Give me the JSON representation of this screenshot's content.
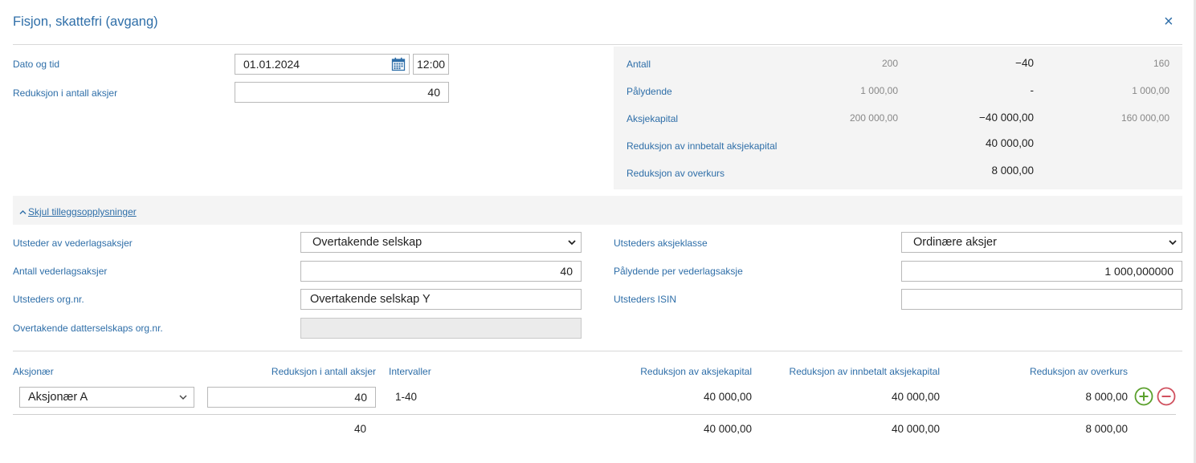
{
  "dialog": {
    "title": "Fisjon, skattefri (avgang)",
    "close_glyph": "×"
  },
  "top_form": {
    "date_label": "Dato og tid",
    "date_value": "01.01.2024",
    "time_value": "12:00",
    "reduction_label": "Reduksjon i antall aksjer",
    "reduction_value": "40"
  },
  "summary": {
    "rows": [
      {
        "label": "Antall",
        "before": "200",
        "change": "−40",
        "after": "160"
      },
      {
        "label": "Pålydende",
        "before": "1 000,00",
        "change": "-",
        "after": "1 000,00"
      },
      {
        "label": "Aksjekapital",
        "before": "200 000,00",
        "change": "−40 000,00",
        "after": "160 000,00"
      },
      {
        "label": "Reduksjon av innbetalt aksjekapital",
        "before": "",
        "change": "40 000,00",
        "after": ""
      },
      {
        "label": "Reduksjon av overkurs",
        "before": "",
        "change": "8 000,00",
        "after": ""
      }
    ]
  },
  "additional": {
    "toggle_label": "Skjul tilleggsopplysninger",
    "issuer_label": "Utsteder av vederlagsaksjer",
    "issuer_value": "Overtakende selskap",
    "consideration_count_label": "Antall vederlagsaksjer",
    "consideration_count_value": "40",
    "issuer_orgnr_label": "Utsteders org.nr.",
    "issuer_orgnr_value": "Overtakende selskap Y",
    "subsidiary_orgnr_label": "Overtakende datterselskaps org.nr.",
    "subsidiary_orgnr_value": "",
    "share_class_label": "Utsteders aksjeklasse",
    "share_class_value": "Ordinære aksjer",
    "par_value_label": "Pålydende per vederlagsaksje",
    "par_value_value": "1 000,000000",
    "isin_label": "Utsteders ISIN",
    "isin_value": ""
  },
  "shareholders": {
    "headers": {
      "shareholder": "Aksjonær",
      "reduction": "Reduksjon i antall aksjer",
      "intervals": "Intervaller",
      "capital": "Reduksjon av aksjekapital",
      "paid_in": "Reduksjon av innbetalt aksjekapital",
      "premium": "Reduksjon av overkurs"
    },
    "row": {
      "shareholder": "Aksjonær A",
      "reduction": "40",
      "intervals": "1-40",
      "capital": "40 000,00",
      "paid_in": "40 000,00",
      "premium": "8 000,00"
    },
    "totals": {
      "reduction": "40",
      "capital": "40 000,00",
      "paid_in": "40 000,00",
      "premium": "8 000,00"
    }
  },
  "colors": {
    "accent": "#2e6ea8",
    "add": "#5aa02c",
    "remove": "#d0505e",
    "panel": "#f4f4f4"
  },
  "icons": [
    "close-icon",
    "calendar-icon",
    "chevron-up-icon",
    "chevron-down-icon",
    "add-circle-icon",
    "remove-circle-icon"
  ]
}
